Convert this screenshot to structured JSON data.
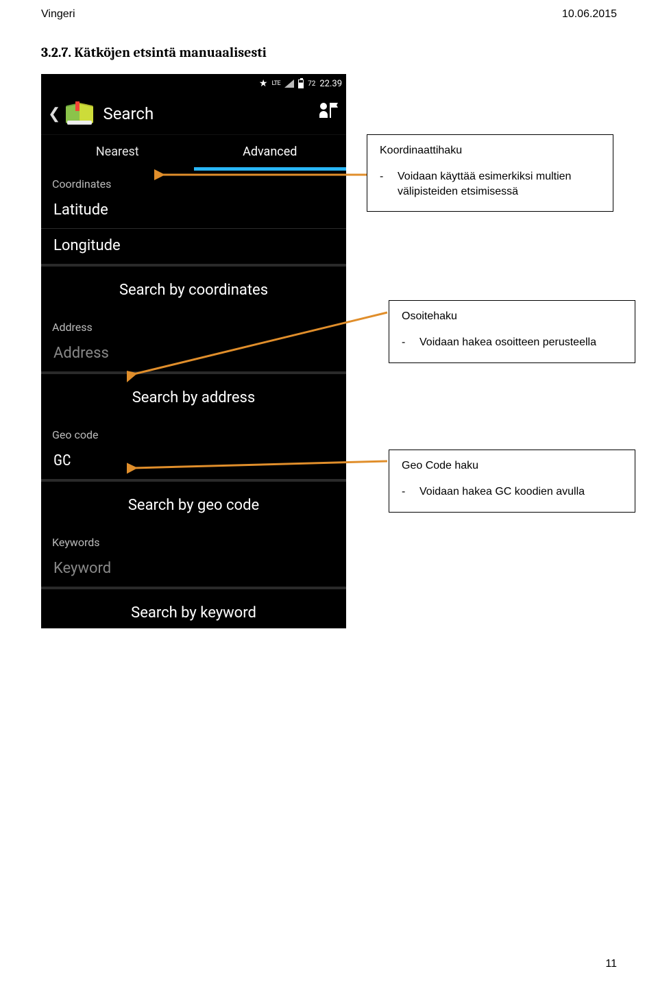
{
  "header": {
    "left": "Vingeri",
    "right": "10.06.2015"
  },
  "section_heading": "3.2.7. Kätköjen etsintä manuaalisesti",
  "phone": {
    "status": {
      "batt": "72",
      "time": "22.39",
      "lte": "LTE"
    },
    "title": "Search",
    "tabs": {
      "nearest": "Nearest",
      "advanced": "Advanced"
    },
    "coordinates": {
      "label": "Coordinates",
      "lat": "Latitude",
      "lon": "Longitude",
      "button": "Search by coordinates"
    },
    "address": {
      "label": "Address",
      "placeholder": "Address",
      "button": "Search by address"
    },
    "geocode": {
      "label": "Geo code",
      "value": "GC",
      "button": "Search by geo code"
    },
    "keywords": {
      "label": "Keywords",
      "placeholder": "Keyword",
      "button": "Search by keyword"
    }
  },
  "callouts": {
    "c1": {
      "title": "Koordinaattihaku",
      "body": "Voidaan käyttää esimerkiksi multien välipisteiden etsimisessä"
    },
    "c2": {
      "title": "Osoitehaku",
      "body": "Voidaan hakea osoitteen perusteella"
    },
    "c3": {
      "title": "Geo Code haku",
      "body": "Voidaan hakea GC koodien avulla"
    }
  },
  "page_number": "11"
}
